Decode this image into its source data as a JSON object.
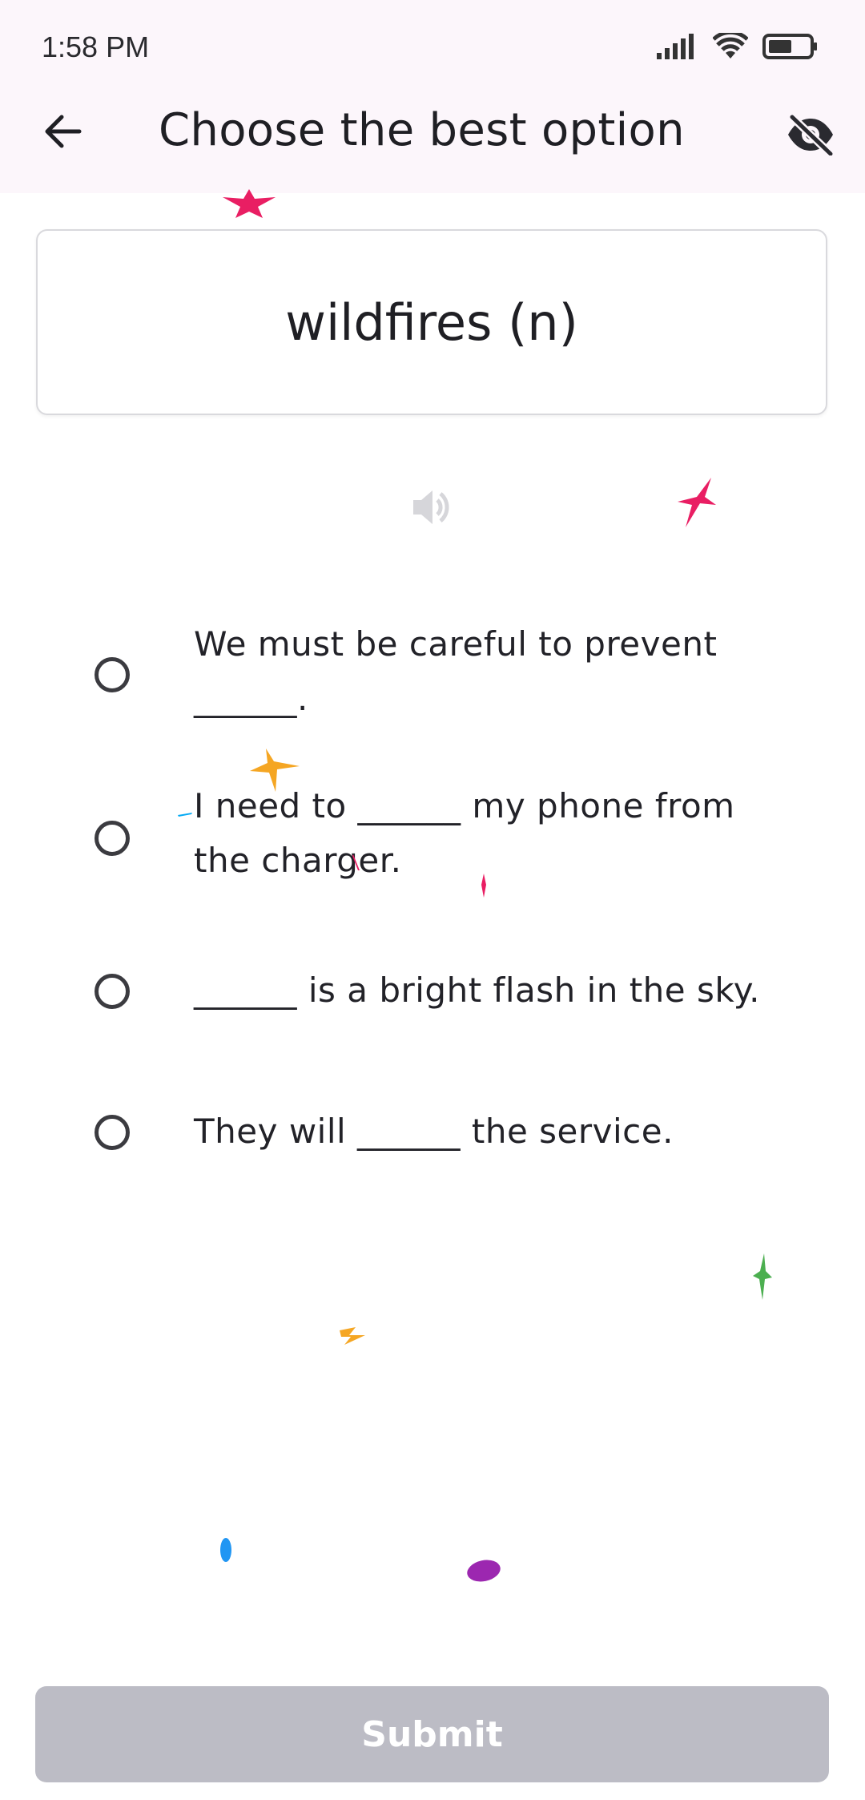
{
  "status_bar": {
    "time": "1:58 PM",
    "icons": [
      "signal-icon",
      "wifi-icon",
      "battery-icon"
    ]
  },
  "header": {
    "title": "Choose the best option",
    "back_icon": "arrow-left-icon",
    "visibility_icon": "eye-off-icon"
  },
  "word_card": {
    "word": "wildfires (n)"
  },
  "audio": {
    "icon": "speaker-icon"
  },
  "options": [
    {
      "text": "We must be careful to prevent ______.",
      "selected": false
    },
    {
      "text": "I need to ______ my phone from the charger.",
      "selected": false
    },
    {
      "text": "______ is a bright flash in the sky.",
      "selected": false
    },
    {
      "text": "They will ______ the service.",
      "selected": false
    }
  ],
  "submit": {
    "label": "Submit",
    "enabled": false
  },
  "colors": {
    "header_bg": "#fcf6fb",
    "submit_disabled": "#bcbcc5",
    "confetti_pink": "#e91e63",
    "confetti_orange": "#f5a623",
    "confetti_green": "#4caf50",
    "confetti_blue": "#2196f3",
    "confetti_purple": "#9c27b0"
  }
}
